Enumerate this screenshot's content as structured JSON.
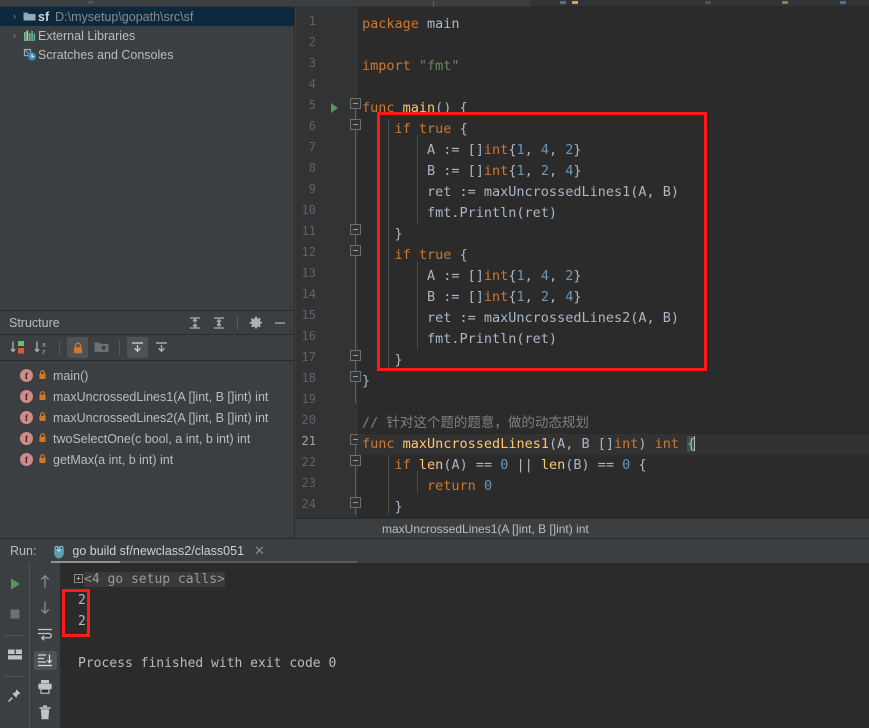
{
  "project": {
    "rows": [
      {
        "arrow": "›",
        "icon": "folder-icon",
        "name": "sf",
        "path": "D:\\mysetup\\gopath\\src\\sf",
        "selected": true
      },
      {
        "arrow": "›",
        "icon": "libraries-icon",
        "name": "External Libraries",
        "path": "",
        "selected": false
      },
      {
        "arrow": "",
        "icon": "scratches-icon",
        "name": "Scratches and Consoles",
        "path": "",
        "selected": false
      }
    ]
  },
  "structure": {
    "title": "Structure",
    "header_icons": [
      "expand-all-icon",
      "collapse-all-icon",
      "settings-gear-icon",
      "hide-panel-icon"
    ],
    "toolbar_icons": [
      "sort-by-visibility-icon",
      "sort-alphabetically-icon",
      "show-non-public-icon",
      "show-fields-icon",
      "expand-all-icon",
      "collapse-all-icon"
    ],
    "items": [
      {
        "badge": "f",
        "label": "main()"
      },
      {
        "badge": "f",
        "label": "maxUncrossedLines1(A []int, B []int) int"
      },
      {
        "badge": "f",
        "label": "maxUncrossedLines2(A []int, B []int) int"
      },
      {
        "badge": "f",
        "label": "twoSelectOne(c bool, a int, b int) int"
      },
      {
        "badge": "f",
        "label": "getMax(a int, b int) int"
      }
    ]
  },
  "editor": {
    "current_line": 21,
    "run_marker_line": 5,
    "lines": [
      {
        "n": 1,
        "text": "package main"
      },
      {
        "n": 2,
        "text": ""
      },
      {
        "n": 3,
        "text": "import \"fmt\""
      },
      {
        "n": 4,
        "text": ""
      },
      {
        "n": 5,
        "text": "func main() {"
      },
      {
        "n": 6,
        "text": "    if true {"
      },
      {
        "n": 7,
        "text": "        A := []int{1, 4, 2}"
      },
      {
        "n": 8,
        "text": "        B := []int{1, 2, 4}"
      },
      {
        "n": 9,
        "text": "        ret := maxUncrossedLines1(A, B)"
      },
      {
        "n": 10,
        "text": "        fmt.Println(ret)"
      },
      {
        "n": 11,
        "text": "    }"
      },
      {
        "n": 12,
        "text": "    if true {"
      },
      {
        "n": 13,
        "text": "        A := []int{1, 4, 2}"
      },
      {
        "n": 14,
        "text": "        B := []int{1, 2, 4}"
      },
      {
        "n": 15,
        "text": "        ret := maxUncrossedLines2(A, B)"
      },
      {
        "n": 16,
        "text": "        fmt.Println(ret)"
      },
      {
        "n": 17,
        "text": "    }"
      },
      {
        "n": 18,
        "text": "}"
      },
      {
        "n": 19,
        "text": ""
      },
      {
        "n": 20,
        "text": "// 针对这个题的题意，做的动态规划"
      },
      {
        "n": 21,
        "text": "func maxUncrossedLines1(A, B []int) int {"
      },
      {
        "n": 22,
        "text": "    if len(A) == 0 || len(B) == 0 {"
      },
      {
        "n": 23,
        "text": "        return 0"
      },
      {
        "n": 24,
        "text": "    }"
      }
    ]
  },
  "breadcrumb": {
    "text": "maxUncrossedLines1(A []int, B []int) int"
  },
  "run": {
    "label": "Run:",
    "tab_title": "go build sf/newclass2/class051",
    "tab_icon": "go-gopher-icon",
    "close_icon": "close-icon",
    "side_buttons": [
      "rerun-play-icon",
      "stop-icon",
      "layout-icon",
      "pin-tab-icon"
    ],
    "side_buttons2": [
      "up-arrow-icon",
      "down-arrow-icon",
      "soft-wrap-icon",
      "scroll-to-end-icon",
      "print-icon",
      "trash-icon"
    ],
    "console": {
      "setup_line": "<4 go setup calls>",
      "outputs": [
        "2",
        "2"
      ],
      "finished": "Process finished with exit code 0"
    }
  },
  "colors": {
    "accent_red": "#ff1a1a",
    "keyword": "#cc7832",
    "string": "#6a8759",
    "number": "#6897bb",
    "function": "#ffc66d",
    "comment": "#808080",
    "text": "#a9b7c6",
    "panel_bg": "#3c3f41",
    "editor_bg": "#2b2b2b",
    "selection_blue": "#0d293e",
    "run_green": "#57965c"
  }
}
